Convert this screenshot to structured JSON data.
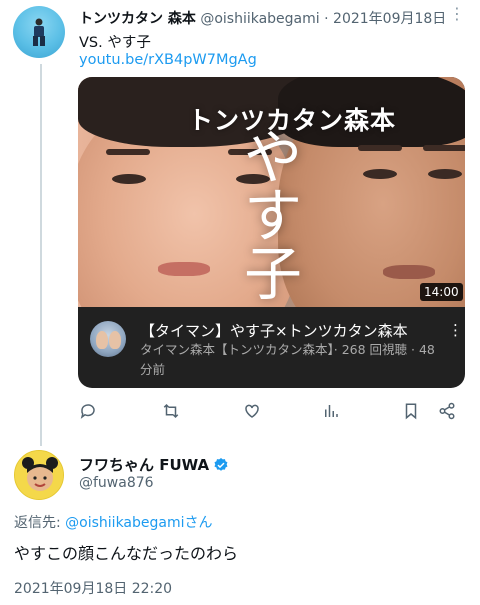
{
  "tweet1": {
    "display_name": "トンツカタン 森本",
    "handle": "@oishiikabegami",
    "separator": "·",
    "date": "2021年09月18日",
    "more_icon": "ellipsis-icon",
    "text": "VS. やす子",
    "link": "youtu.be/rXB4pW7MgAg",
    "card": {
      "thumb_title": "トンツカタン森本",
      "thumb_big": "やす子",
      "duration": "14:00",
      "video_title": "【タイマン】やす子×トンツカタン森本",
      "meta": "タイマン森本【トンツカタン森本】· 268 回視聴 · 48 分前"
    },
    "actions": [
      "reply-icon",
      "retweet-icon",
      "like-icon",
      "views-icon",
      "bookmark-icon",
      "share-icon"
    ]
  },
  "tweet2": {
    "display_name": "フワちゃん FUWA",
    "handle": "@fuwa876",
    "reply_prefix": "返信先:",
    "reply_handle": "@oishiikabegamiさん",
    "text": "やすこの顔こんなだったのわら",
    "timestamp": "2021年09月18日 22:20",
    "verified_color": "#1d9bf0"
  },
  "colors": {
    "accent": "#1d9bf0",
    "secondary_text": "#536471",
    "thread_line": "#cfd9de"
  }
}
